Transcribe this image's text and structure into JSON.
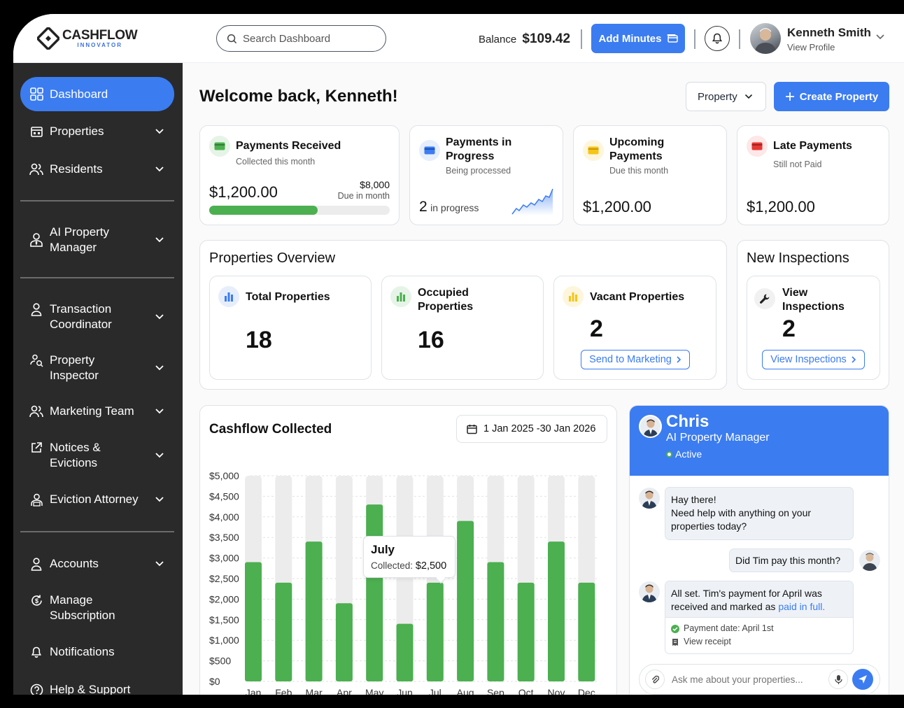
{
  "header": {
    "logo_main": "CASHFLOW",
    "logo_sub": "INNOVATOR",
    "search_placeholder": "Search Dashboard",
    "balance_label": "Balance",
    "balance_value": "$109.42",
    "add_minutes_label": "Add Minutes",
    "user_name": "Kenneth Smith",
    "user_link": "View Profile"
  },
  "sidebar": {
    "items": [
      {
        "label": "Dashboard",
        "icon": "grid-icon",
        "active": true
      },
      {
        "label": "Properties",
        "icon": "building-icon"
      },
      {
        "label": "Residents",
        "icon": "users-icon"
      },
      {
        "label": "AI Property Manager",
        "icon": "user-tie-icon"
      },
      {
        "label": "Transaction Coordinator",
        "icon": "user-icon"
      },
      {
        "label": "Property Inspector",
        "icon": "inspector-icon"
      },
      {
        "label": "Marketing Team",
        "icon": "users-icon"
      },
      {
        "label": "Notices & Evictions",
        "icon": "external-icon"
      },
      {
        "label": "Eviction Attorney",
        "icon": "attorney-icon"
      },
      {
        "label": "Accounts",
        "icon": "user-icon"
      },
      {
        "label": "Manage Subscription",
        "icon": "dollar-cycle-icon"
      },
      {
        "label": "Notifications",
        "icon": "bell-icon"
      },
      {
        "label": "Help & Support",
        "icon": "help-icon"
      }
    ]
  },
  "main": {
    "welcome": "Welcome back, Kenneth!",
    "property_select": "Property",
    "create_property": "Create Property"
  },
  "kpis": {
    "received": {
      "title": "Payments Received",
      "sub": "Collected this month",
      "value": "$1,200.00",
      "due_value": "$8,000",
      "due_label": "Due in month",
      "progress": 0.6,
      "color": "#4caf50"
    },
    "progress": {
      "title": "Payments in Progress",
      "sub": "Being processed",
      "count": "2",
      "count_label": "in progress",
      "color": "#3b7cf1"
    },
    "upcoming": {
      "title": "Upcoming Payments",
      "sub": "Due this month",
      "value": "$1,200.00",
      "color": "#f5c518"
    },
    "late": {
      "title": "Late Payments",
      "sub": "Still not Paid",
      "value": "$1,200.00",
      "color": "#e53935"
    }
  },
  "overview": {
    "title": "Properties Overview",
    "total": {
      "label": "Total Properties",
      "value": "18"
    },
    "occupied": {
      "label": "Occupied Properties",
      "value": "16"
    },
    "vacant": {
      "label": "Vacant Properties",
      "value": "2",
      "button": "Send to Marketing"
    }
  },
  "inspections": {
    "title": "New Inspections",
    "label": "View Inspections",
    "value": "2",
    "button": "View Inspections"
  },
  "cashflow": {
    "title": "Cashflow Collected",
    "date_range": "1 Jan 2025 -30 Jan 2026",
    "tooltip_month": "July",
    "tooltip_label": "Collected:",
    "tooltip_value": "$2,500"
  },
  "chart_data": {
    "type": "bar",
    "categories": [
      "Jan",
      "Feb",
      "Mar",
      "Apr",
      "May",
      "Jun",
      "Jul",
      "Aug",
      "Sep",
      "Oct",
      "Nov",
      "Dec"
    ],
    "values": [
      2900,
      2400,
      3400,
      1900,
      4300,
      1400,
      2400,
      3900,
      2900,
      2400,
      3400,
      2400
    ],
    "ylim": [
      0,
      5000
    ],
    "yticks": [
      "$5,000",
      "$4,500",
      "$4,000",
      "$3,500",
      "$3,000",
      "$2,500",
      "$2,000",
      "$1,500",
      "$1,000",
      "$500",
      "$0"
    ],
    "bar_color": "#4caf50",
    "track_color": "#ececec"
  },
  "chat": {
    "name": "Chris",
    "role": "AI Property Manager",
    "status": "Active",
    "msg1_line1": "Hay there!",
    "msg1_line2": "Need help with anything on your properties today?",
    "msg2": "Did Tim pay this month?",
    "msg3_text": "All set. Tim's payment for April was received and marked as",
    "msg3_link": "paid in full.",
    "msg3_date": "Payment date: April 1st",
    "msg3_receipt": "View receipt",
    "input_placeholder": "Ask me about your properties..."
  }
}
